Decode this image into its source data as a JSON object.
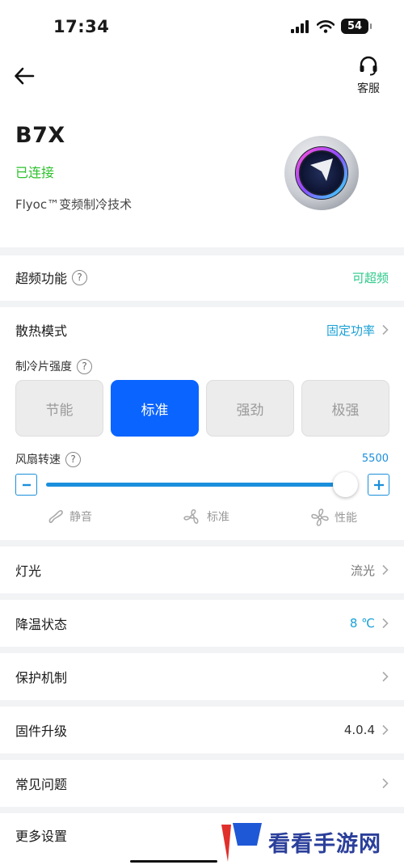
{
  "status_bar": {
    "time": "17:34",
    "battery": "54"
  },
  "header": {
    "service_label": "客服",
    "device_name": "B7X",
    "device_status": "已连接",
    "device_tech": "Flyoc™变频制冷技术"
  },
  "overclock": {
    "label": "超频功能",
    "value": "可超频",
    "help_symbol": "?"
  },
  "cooling_mode": {
    "label": "散热模式",
    "value": "固定功率",
    "intensity_label": "制冷片强度",
    "intensity_options": [
      "节能",
      "标准",
      "强劲",
      "极强"
    ],
    "intensity_selected": "标准",
    "fan_label": "风扇转速",
    "fan_value": "5500",
    "fan_level_fraction": 1.0,
    "fan_presets": [
      "静音",
      "标准",
      "性能"
    ]
  },
  "menu": {
    "light": {
      "label": "灯光",
      "value": "流光"
    },
    "cooling_status": {
      "label": "降温状态",
      "value": "8 ℃"
    },
    "protection": {
      "label": "保护机制"
    },
    "firmware": {
      "label": "固件升级",
      "value": "4.0.4"
    },
    "faq": {
      "label": "常见问题"
    },
    "more": {
      "label": "更多设置"
    }
  },
  "watermark": {
    "text": "看看手游网"
  },
  "colors": {
    "accent_blue": "#0a64ff",
    "connected_green": "#2ec12e",
    "value_blue": "#1aa0d6",
    "value_green": "#2ec98a"
  }
}
